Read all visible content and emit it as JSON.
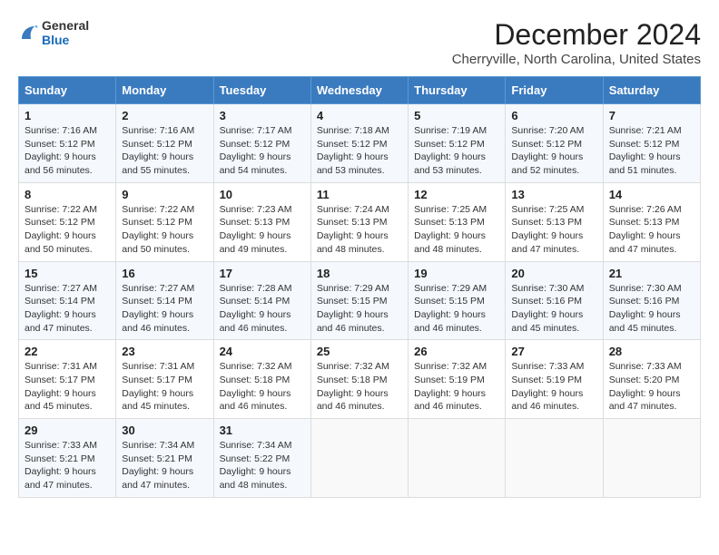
{
  "logo": {
    "text_general": "General",
    "text_blue": "Blue"
  },
  "title": "December 2024",
  "subtitle": "Cherryville, North Carolina, United States",
  "headers": [
    "Sunday",
    "Monday",
    "Tuesday",
    "Wednesday",
    "Thursday",
    "Friday",
    "Saturday"
  ],
  "weeks": [
    [
      {
        "day": "1",
        "sunrise": "7:16 AM",
        "sunset": "5:12 PM",
        "daylight": "9 hours and 56 minutes."
      },
      {
        "day": "2",
        "sunrise": "7:16 AM",
        "sunset": "5:12 PM",
        "daylight": "9 hours and 55 minutes."
      },
      {
        "day": "3",
        "sunrise": "7:17 AM",
        "sunset": "5:12 PM",
        "daylight": "9 hours and 54 minutes."
      },
      {
        "day": "4",
        "sunrise": "7:18 AM",
        "sunset": "5:12 PM",
        "daylight": "9 hours and 53 minutes."
      },
      {
        "day": "5",
        "sunrise": "7:19 AM",
        "sunset": "5:12 PM",
        "daylight": "9 hours and 53 minutes."
      },
      {
        "day": "6",
        "sunrise": "7:20 AM",
        "sunset": "5:12 PM",
        "daylight": "9 hours and 52 minutes."
      },
      {
        "day": "7",
        "sunrise": "7:21 AM",
        "sunset": "5:12 PM",
        "daylight": "9 hours and 51 minutes."
      }
    ],
    [
      {
        "day": "8",
        "sunrise": "7:22 AM",
        "sunset": "5:12 PM",
        "daylight": "9 hours and 50 minutes."
      },
      {
        "day": "9",
        "sunrise": "7:22 AM",
        "sunset": "5:12 PM",
        "daylight": "9 hours and 50 minutes."
      },
      {
        "day": "10",
        "sunrise": "7:23 AM",
        "sunset": "5:13 PM",
        "daylight": "9 hours and 49 minutes."
      },
      {
        "day": "11",
        "sunrise": "7:24 AM",
        "sunset": "5:13 PM",
        "daylight": "9 hours and 48 minutes."
      },
      {
        "day": "12",
        "sunrise": "7:25 AM",
        "sunset": "5:13 PM",
        "daylight": "9 hours and 48 minutes."
      },
      {
        "day": "13",
        "sunrise": "7:25 AM",
        "sunset": "5:13 PM",
        "daylight": "9 hours and 47 minutes."
      },
      {
        "day": "14",
        "sunrise": "7:26 AM",
        "sunset": "5:13 PM",
        "daylight": "9 hours and 47 minutes."
      }
    ],
    [
      {
        "day": "15",
        "sunrise": "7:27 AM",
        "sunset": "5:14 PM",
        "daylight": "9 hours and 47 minutes."
      },
      {
        "day": "16",
        "sunrise": "7:27 AM",
        "sunset": "5:14 PM",
        "daylight": "9 hours and 46 minutes."
      },
      {
        "day": "17",
        "sunrise": "7:28 AM",
        "sunset": "5:14 PM",
        "daylight": "9 hours and 46 minutes."
      },
      {
        "day": "18",
        "sunrise": "7:29 AM",
        "sunset": "5:15 PM",
        "daylight": "9 hours and 46 minutes."
      },
      {
        "day": "19",
        "sunrise": "7:29 AM",
        "sunset": "5:15 PM",
        "daylight": "9 hours and 46 minutes."
      },
      {
        "day": "20",
        "sunrise": "7:30 AM",
        "sunset": "5:16 PM",
        "daylight": "9 hours and 45 minutes."
      },
      {
        "day": "21",
        "sunrise": "7:30 AM",
        "sunset": "5:16 PM",
        "daylight": "9 hours and 45 minutes."
      }
    ],
    [
      {
        "day": "22",
        "sunrise": "7:31 AM",
        "sunset": "5:17 PM",
        "daylight": "9 hours and 45 minutes."
      },
      {
        "day": "23",
        "sunrise": "7:31 AM",
        "sunset": "5:17 PM",
        "daylight": "9 hours and 45 minutes."
      },
      {
        "day": "24",
        "sunrise": "7:32 AM",
        "sunset": "5:18 PM",
        "daylight": "9 hours and 46 minutes."
      },
      {
        "day": "25",
        "sunrise": "7:32 AM",
        "sunset": "5:18 PM",
        "daylight": "9 hours and 46 minutes."
      },
      {
        "day": "26",
        "sunrise": "7:32 AM",
        "sunset": "5:19 PM",
        "daylight": "9 hours and 46 minutes."
      },
      {
        "day": "27",
        "sunrise": "7:33 AM",
        "sunset": "5:19 PM",
        "daylight": "9 hours and 46 minutes."
      },
      {
        "day": "28",
        "sunrise": "7:33 AM",
        "sunset": "5:20 PM",
        "daylight": "9 hours and 47 minutes."
      }
    ],
    [
      {
        "day": "29",
        "sunrise": "7:33 AM",
        "sunset": "5:21 PM",
        "daylight": "9 hours and 47 minutes."
      },
      {
        "day": "30",
        "sunrise": "7:34 AM",
        "sunset": "5:21 PM",
        "daylight": "9 hours and 47 minutes."
      },
      {
        "day": "31",
        "sunrise": "7:34 AM",
        "sunset": "5:22 PM",
        "daylight": "9 hours and 48 minutes."
      },
      null,
      null,
      null,
      null
    ]
  ],
  "labels": {
    "sunrise": "Sunrise:",
    "sunset": "Sunset:",
    "daylight": "Daylight:"
  }
}
